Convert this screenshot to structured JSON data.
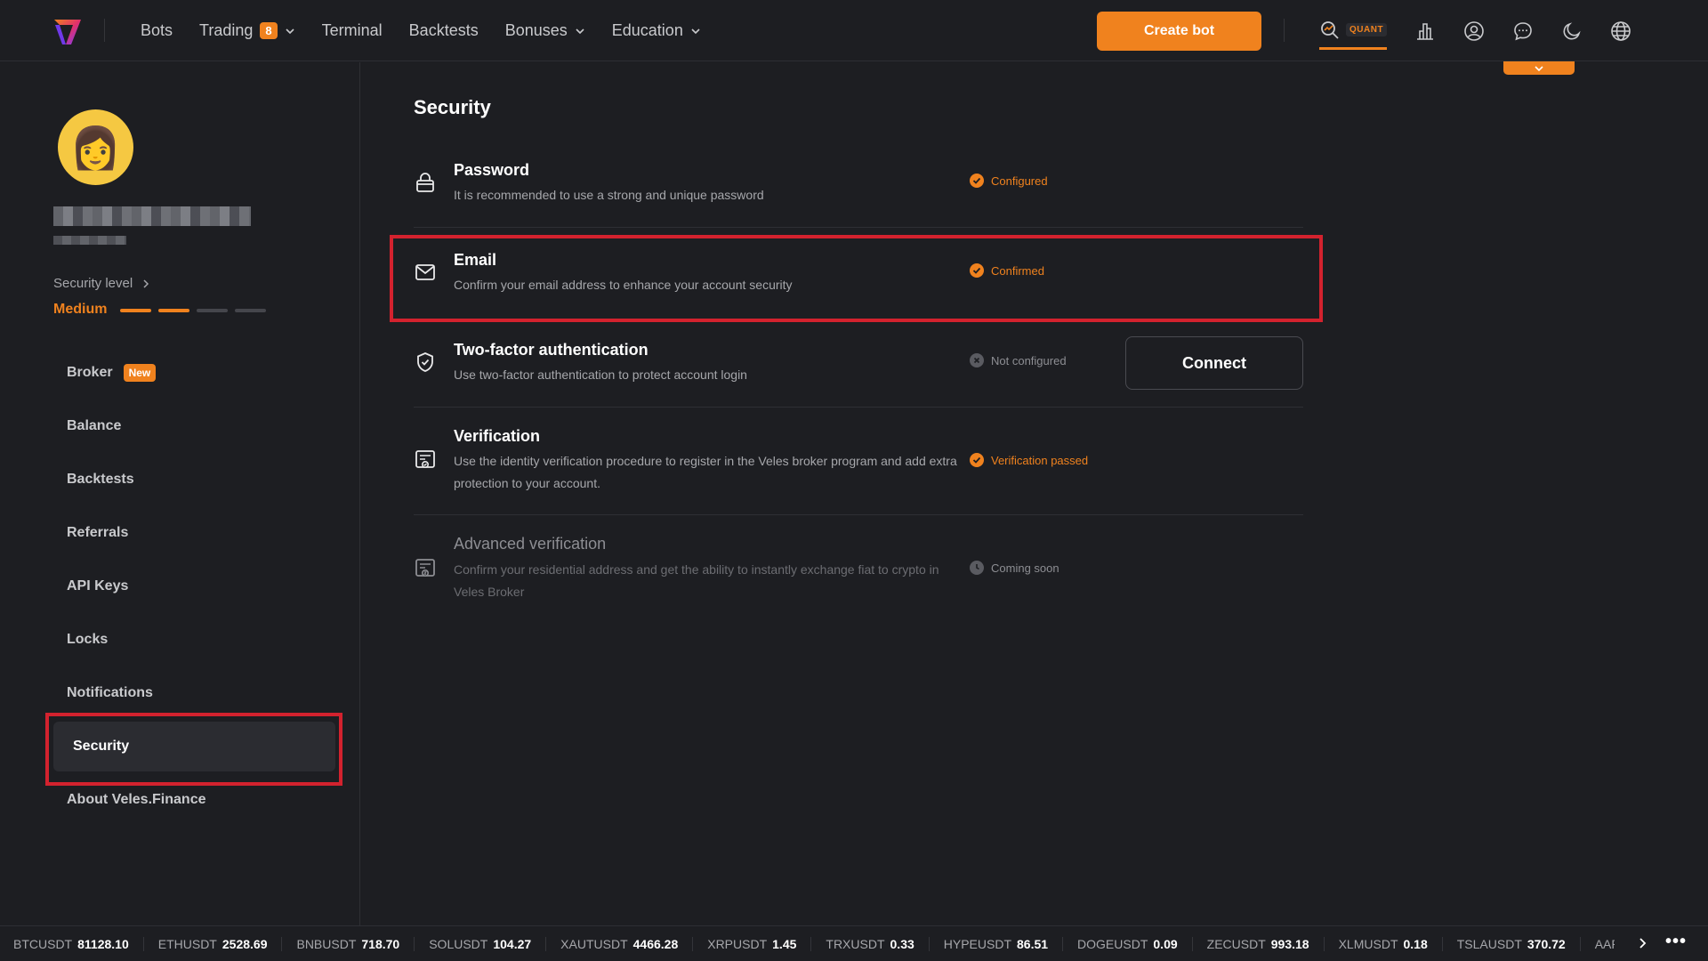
{
  "nav": {
    "items": [
      {
        "label": "Bots"
      },
      {
        "label": "Trading",
        "badge": "8"
      },
      {
        "label": "Terminal"
      },
      {
        "label": "Backtests"
      },
      {
        "label": "Bonuses"
      },
      {
        "label": "Education"
      }
    ],
    "create_bot": "Create bot",
    "quant_label": "QUANT"
  },
  "sidebar": {
    "security_level_label": "Security level",
    "security_level_value": "Medium",
    "security_level_filled": 2,
    "security_level_total": 4,
    "menu": [
      {
        "label": "Broker",
        "badge": "New"
      },
      {
        "label": "Balance"
      },
      {
        "label": "Backtests"
      },
      {
        "label": "Referrals"
      },
      {
        "label": "API Keys"
      },
      {
        "label": "Locks"
      },
      {
        "label": "Notifications"
      },
      {
        "label": "Security",
        "active": true
      },
      {
        "label": "About Veles.Finance"
      }
    ]
  },
  "main": {
    "title": "Security",
    "rows": [
      {
        "title": "Password",
        "desc": "It is recommended to use a strong and unique password",
        "status": "Configured",
        "icon": "lock-icon"
      },
      {
        "title": "Email",
        "desc": "Confirm your email address to enhance your account security",
        "status": "Confirmed",
        "icon": "mail-icon"
      },
      {
        "title": "Two-factor authentication",
        "desc": "Use two-factor authentication to protect account login",
        "status": "Not configured",
        "action": "Connect",
        "icon": "shield-icon"
      },
      {
        "title": "Verification",
        "desc": "Use the identity verification procedure to register in the Veles broker program and add extra protection to your account.",
        "status": "Verification passed",
        "icon": "id-card-icon"
      },
      {
        "title": "Advanced verification",
        "desc": "Confirm your residential address and get the ability to instantly exchange fiat to crypto in Veles Broker",
        "status": "Coming soon",
        "icon": "id-card-2-icon"
      }
    ]
  },
  "ticker": [
    {
      "symbol": "BTCUSDT",
      "price": "81128.10"
    },
    {
      "symbol": "ETHUSDT",
      "price": "2528.69"
    },
    {
      "symbol": "BNBUSDT",
      "price": "718.70"
    },
    {
      "symbol": "SOLUSDT",
      "price": "104.27"
    },
    {
      "symbol": "XAUTUSDT",
      "price": "4466.28"
    },
    {
      "symbol": "XRPUSDT",
      "price": "1.45"
    },
    {
      "symbol": "TRXUSDT",
      "price": "0.33"
    },
    {
      "symbol": "HYPEUSDT",
      "price": "86.51"
    },
    {
      "symbol": "DOGEUSDT",
      "price": "0.09"
    },
    {
      "symbol": "ZECUSDT",
      "price": "993.18"
    },
    {
      "symbol": "XLMUSDT",
      "price": "0.18"
    },
    {
      "symbol": "TSLAUSDT",
      "price": "370.72"
    },
    {
      "symbol": "AAPLUSDT",
      "price": ""
    }
  ],
  "colors": {
    "accent": "#f0821e",
    "background": "#1d1e22",
    "highlight": "#d3222e"
  }
}
